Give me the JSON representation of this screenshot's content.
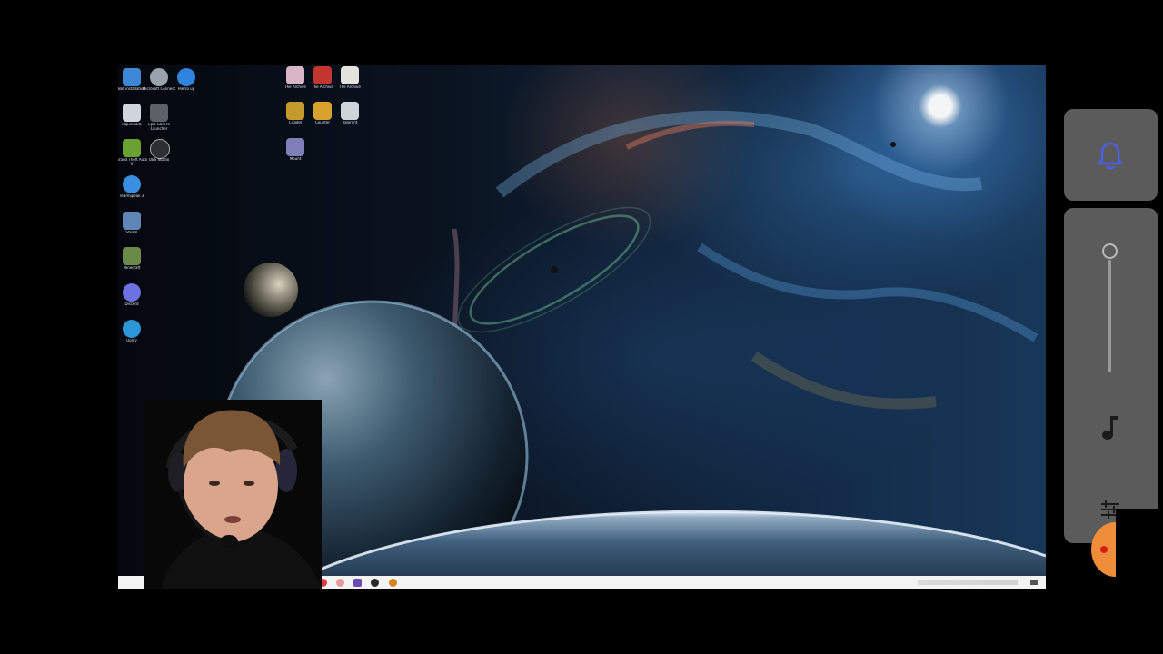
{
  "desktop": {
    "left_icons": [
      {
        "name": "app-icon-1",
        "label": "Bot installation",
        "color": "#3e86d6"
      },
      {
        "name": "app-icon-2",
        "label": "Microsoft Connect",
        "color": "#9aa3ad"
      },
      {
        "name": "app-icon-3",
        "label": "Hierro up",
        "color": "#2e84de"
      },
      {
        "name": "recycle-bin-icon",
        "label": "Papierkorb",
        "color": "#cfd5db"
      },
      {
        "name": "epic-launcher-icon",
        "label": "Epic Games Launcher",
        "color": "#5d6267"
      },
      {
        "name": "nvidia-icon",
        "label": "Grand Theft Auto V",
        "color": "#6aa131"
      },
      {
        "name": "obs-icon",
        "label": "OBS Studio",
        "color": "#2c2f33"
      },
      {
        "name": "teamspeak-icon",
        "label": "TeamSpeak 3",
        "color": "#3b8fe0"
      },
      {
        "name": "steam-icon",
        "label": "Steam",
        "color": "#5f87b5"
      },
      {
        "name": "minecraft-icon",
        "label": "Minecraft",
        "color": "#6b8a4a"
      },
      {
        "name": "discord-icon",
        "label": "Discord",
        "color": "#6d72e3"
      },
      {
        "name": "uplay-icon",
        "label": "Uplay",
        "color": "#2b96d8"
      }
    ],
    "middle_icons": [
      {
        "name": "doc-icon-1",
        "label": "The Archive",
        "color": "#d9b6c7"
      },
      {
        "name": "doc-icon-2",
        "label": "The Archive",
        "color": "#c2362f"
      },
      {
        "name": "doc-icon-3",
        "label": "The Archive",
        "color": "#e4e2dc"
      },
      {
        "name": "game-icon-1",
        "label": "Citadel",
        "color": "#c59a2c"
      },
      {
        "name": "game-icon-2",
        "label": "Counter",
        "color": "#d7a22e"
      },
      {
        "name": "game-icon-3",
        "label": "Valorant",
        "color": "#cfd4d9"
      },
      {
        "name": "game-icon-4",
        "label": "Mount",
        "color": "#7d7fb6"
      }
    ],
    "taskbar": {
      "apps": [
        {
          "name": "taskbar-app-1",
          "color": "#e23a3a"
        },
        {
          "name": "taskbar-app-2",
          "color": "#e69a9a"
        },
        {
          "name": "taskbar-app-3",
          "color": "#6b4ab2"
        },
        {
          "name": "taskbar-app-4",
          "color": "#2a2a2a"
        },
        {
          "name": "taskbar-app-5",
          "color": "#d9831f"
        }
      ],
      "tray_text": "",
      "clock": ""
    }
  },
  "side_panel": {
    "icons": {
      "bell": "bell-icon",
      "music": "music-note-icon",
      "settings": "tune-icon"
    },
    "accent": "#4b5ff0",
    "panel_color": "#5b5b5b",
    "record_color": "#f08d3a"
  }
}
